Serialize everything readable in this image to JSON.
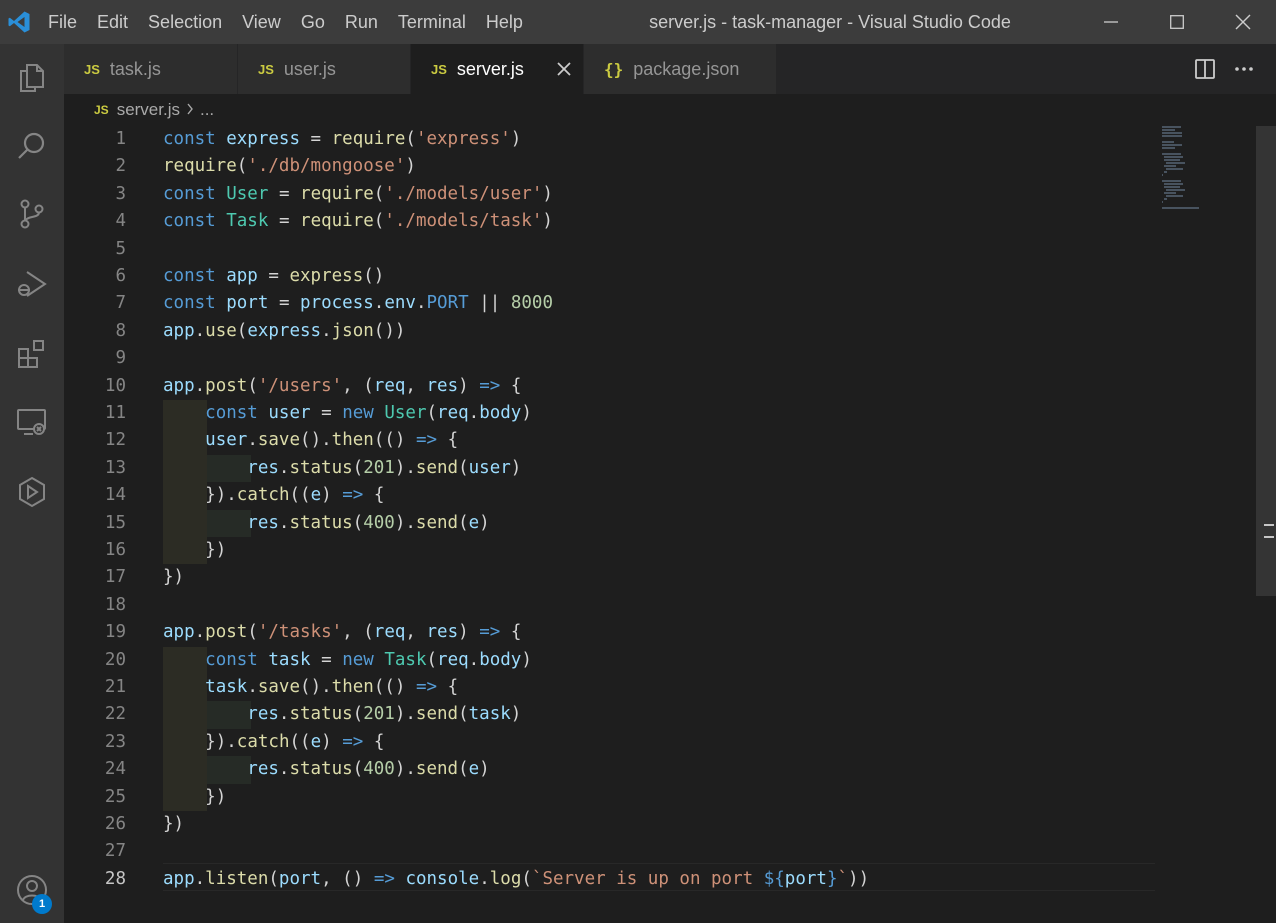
{
  "window": {
    "title": "server.js - task-manager - Visual Studio Code"
  },
  "menu": [
    "File",
    "Edit",
    "Selection",
    "View",
    "Go",
    "Run",
    "Terminal",
    "Help"
  ],
  "tabs": [
    {
      "label": "task.js",
      "type": "js",
      "active": false
    },
    {
      "label": "user.js",
      "type": "js",
      "active": false
    },
    {
      "label": "server.js",
      "type": "js",
      "active": true
    },
    {
      "label": "package.json",
      "type": "json",
      "active": false
    }
  ],
  "file_icons": {
    "js": "JS",
    "json": "{}"
  },
  "breadcrumb": {
    "file": "server.js",
    "rest": "..."
  },
  "activity": {
    "icons": [
      "explorer-icon",
      "search-icon",
      "source-control-icon",
      "run-debug-icon",
      "extensions-icon",
      "remote-explorer-icon",
      "docker-icon"
    ],
    "accounts_badge": "1"
  },
  "editor": {
    "current_line": 28,
    "line_numbers": [
      "1",
      "2",
      "3",
      "4",
      "5",
      "6",
      "7",
      "8",
      "9",
      "10",
      "11",
      "12",
      "13",
      "14",
      "15",
      "16",
      "17",
      "18",
      "19",
      "20",
      "21",
      "22",
      "23",
      "24",
      "25",
      "26",
      "27",
      "28"
    ],
    "lines": [
      "const express = require('express')",
      "require('./db/mongoose')",
      "const User = require('./models/user')",
      "const Task = require('./models/task')",
      "",
      "const app = express()",
      "const port = process.env.PORT || 8000",
      "app.use(express.json())",
      "",
      "app.post('/users', (req, res) => {",
      "    const user = new User(req.body)",
      "    user.save().then(() => {",
      "        res.status(201).send(user)",
      "    }).catch((e) => {",
      "        res.status(400).send(e)",
      "    })",
      "})",
      "",
      "app.post('/tasks', (req, res) => {",
      "    const task = new Task(req.body)",
      "    task.save().then(() => {",
      "        res.status(201).send(task)",
      "    }).catch((e) => {",
      "        res.status(400).send(e)",
      "    })",
      "})",
      "",
      "app.listen(port, () => console.log(`Server is up on port ${port}`))"
    ]
  },
  "colors": {
    "keyword": "#569cd6",
    "variable": "#9cdcfe",
    "class": "#4ec9b0",
    "function": "#dcdcaa",
    "string": "#ce9178",
    "number": "#b5cea8",
    "accent": "#007acc"
  }
}
